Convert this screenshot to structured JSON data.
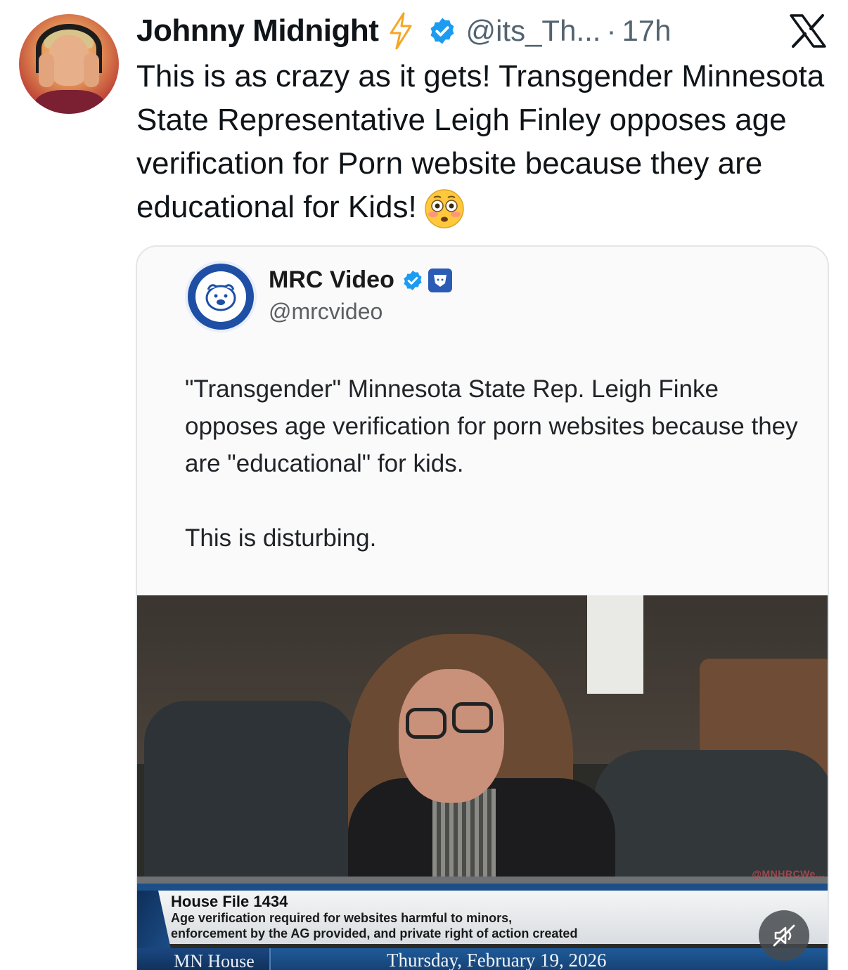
{
  "post": {
    "author_name": "Johnny Midnight",
    "handle": "@its_Th...",
    "separator": "·",
    "time": "17h",
    "text": "This is as crazy as it gets! Transgender Minnesota State Representative Leigh Finley opposes age verification for Porn website because they are educational for Kids!",
    "emoji": "flushed-face-icon"
  },
  "quote": {
    "author_name": "MRC Video",
    "handle": "@mrcvideo",
    "paragraph1": "\"Transgender\" Minnesota State Rep. Leigh Finke opposes age verification for porn websites because they are \"educational\" for kids.",
    "paragraph2": "This is disturbing.",
    "video": {
      "bill_title": "House File 1434",
      "bill_desc_line1": "Age verification required for websites harmful to minors,",
      "bill_desc_line2": "enforcement by the AG provided, and private right of action created",
      "channel": "MN House",
      "date": "Thursday, February 19, 2026",
      "watermark": "@MNHRCWe..."
    }
  },
  "colors": {
    "verified_blue": "#1d9bf0",
    "text_primary": "#0f1419",
    "text_secondary": "#536471",
    "bolt_orange": "#f5a623"
  }
}
